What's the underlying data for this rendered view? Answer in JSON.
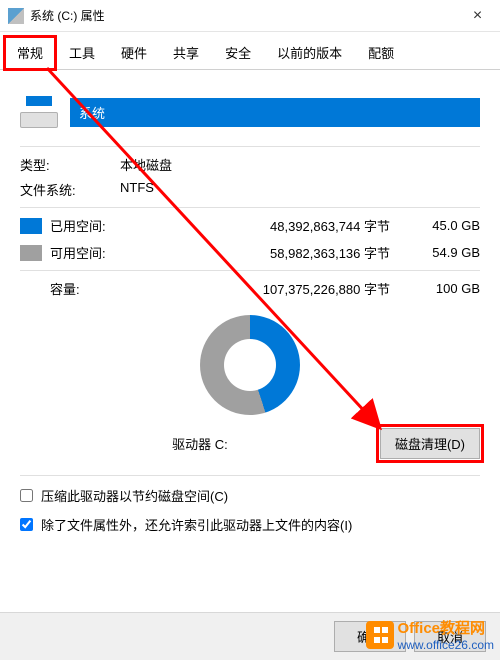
{
  "window": {
    "title": "系统 (C:) 属性",
    "close": "×"
  },
  "tabs": {
    "general": "常规",
    "tools": "工具",
    "hardware": "硬件",
    "sharing": "共享",
    "security": "安全",
    "previous": "以前的版本",
    "quota": "配额"
  },
  "drive": {
    "name": "系统"
  },
  "info": {
    "type_label": "类型:",
    "type_value": "本地磁盘",
    "fs_label": "文件系统:",
    "fs_value": "NTFS"
  },
  "space": {
    "used_label": "已用空间:",
    "used_bytes": "48,392,863,744 字节",
    "used_size": "45.0 GB",
    "free_label": "可用空间:",
    "free_bytes": "58,982,363,136 字节",
    "free_size": "54.9 GB",
    "cap_label": "容量:",
    "cap_bytes": "107,375,226,880 字节",
    "cap_size": "100 GB"
  },
  "drive_c": "驱动器 C:",
  "cleanup": "磁盘清理(D)",
  "checks": {
    "compress": "压缩此驱动器以节约磁盘空间(C)",
    "index": "除了文件属性外，还允许索引此驱动器上文件的内容(I)"
  },
  "buttons": {
    "ok": "确定",
    "cancel": "取消"
  },
  "watermark": {
    "t1": "Office教程网",
    "t2": "www.office26.com"
  }
}
